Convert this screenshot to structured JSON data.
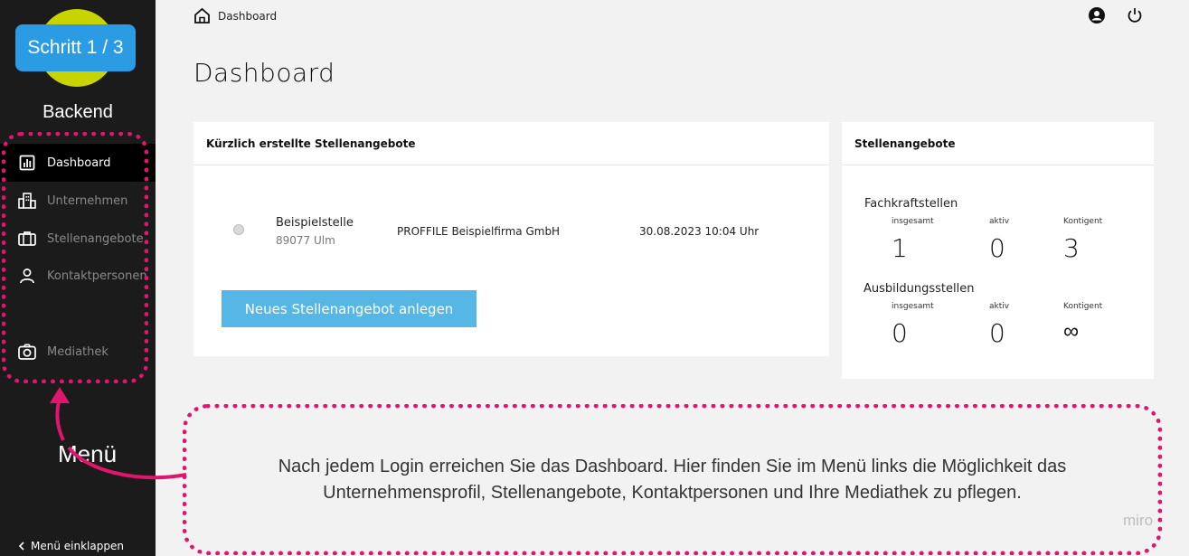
{
  "sidebar": {
    "step_badge": "Schritt 1 / 3",
    "brand": "Backend",
    "items": [
      {
        "label": "Dashboard",
        "icon": "chart-icon",
        "active": true
      },
      {
        "label": "Unternehmen",
        "icon": "building-icon"
      },
      {
        "label": "Stellenangebote",
        "icon": "briefcase-icon"
      },
      {
        "label": "Kontaktpersonen",
        "icon": "person-icon"
      },
      {
        "label": "Mediathek",
        "icon": "camera-icon"
      }
    ],
    "collapse_label": "Menü einklappen",
    "annotation_label": "Menü"
  },
  "topbar": {
    "breadcrumb": "Dashboard",
    "icons": [
      "account-icon",
      "power-icon"
    ]
  },
  "page": {
    "title": "Dashboard"
  },
  "recent_jobs": {
    "header": "Kürzlich erstellte Stellenangebote",
    "rows": [
      {
        "title": "Beispielstelle",
        "location": "89077 Ulm",
        "company": "PROFFILE Beispielfirma GmbH",
        "date": "30.08.2023 10:04 Uhr"
      }
    ],
    "new_button": "Neues Stellenangebot anlegen"
  },
  "job_stats": {
    "header": "Stellenangebote",
    "groups": [
      {
        "title": "Fachkraftstellen",
        "labels": [
          "insgesamt",
          "aktiv",
          "Kontigent"
        ],
        "values": [
          "1",
          "0",
          "3"
        ]
      },
      {
        "title": "Ausbildungsstellen",
        "labels": [
          "insgesamt",
          "aktiv",
          "Kontigent"
        ],
        "values": [
          "0",
          "0",
          "∞"
        ]
      }
    ]
  },
  "annotation": {
    "text_line1": "Nach jedem Login erreichen Sie das Dashboard. Hier finden Sie im Menü links die Möglichkeit das",
    "text_line2": "Unternehmensprofil, Stellenangebote, Kontaktpersonen und Ihre Mediathek zu pflegen.",
    "watermark": "miro"
  },
  "colors": {
    "sidebar_bg": "#1b1b1b",
    "accent_blue": "#56b6e6",
    "highlight_pink": "#e0156e",
    "logo_green": "#c8d400"
  }
}
